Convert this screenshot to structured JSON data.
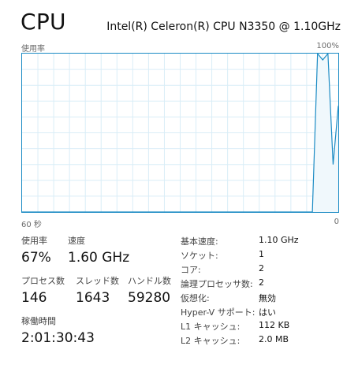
{
  "header": {
    "title": "CPU",
    "model": "Intel(R) Celeron(R) CPU N3350 @ 1.10GHz"
  },
  "graph": {
    "usage_label": "使用率",
    "max_label": "100%",
    "time_label": "60 秒",
    "min_label": "0",
    "line_color": "#1b8bc4",
    "fill_color": "#f0f8fc",
    "grid_color": "#d9edf7"
  },
  "chart_data": {
    "type": "area",
    "x": [
      60,
      59,
      58,
      57,
      56,
      55,
      54,
      53,
      52,
      51,
      50,
      49,
      48,
      47,
      46,
      45,
      44,
      43,
      42,
      41,
      40,
      39,
      38,
      37,
      36,
      35,
      34,
      33,
      32,
      31,
      30,
      29,
      28,
      27,
      26,
      25,
      24,
      23,
      22,
      21,
      20,
      19,
      18,
      17,
      16,
      15,
      14,
      13,
      12,
      11,
      10,
      9,
      8,
      7,
      6,
      5,
      4,
      3,
      2,
      1,
      0
    ],
    "values": [
      0,
      0,
      0,
      0,
      0,
      0,
      0,
      0,
      0,
      0,
      0,
      0,
      0,
      0,
      0,
      0,
      0,
      0,
      0,
      0,
      0,
      0,
      0,
      0,
      0,
      0,
      0,
      0,
      0,
      0,
      0,
      0,
      0,
      0,
      0,
      0,
      0,
      0,
      0,
      0,
      0,
      0,
      0,
      0,
      0,
      0,
      0,
      0,
      0,
      0,
      0,
      0,
      0,
      0,
      0,
      0,
      0,
      100,
      96,
      100,
      30,
      67
    ],
    "ylim": [
      0,
      100
    ]
  },
  "stats": {
    "usage": {
      "label": "使用率",
      "value": "67%"
    },
    "speed": {
      "label": "速度",
      "value": "1.60 GHz"
    },
    "processes": {
      "label": "プロセス数",
      "value": "146"
    },
    "threads": {
      "label": "スレッド数",
      "value": "1643"
    },
    "handles": {
      "label": "ハンドル数",
      "value": "59280"
    },
    "uptime": {
      "label": "稼働時間",
      "value": "2:01:30:43"
    }
  },
  "info": [
    {
      "label": "基本速度:",
      "value": "1.10 GHz"
    },
    {
      "label": "ソケット:",
      "value": "1"
    },
    {
      "label": "コア:",
      "value": "2"
    },
    {
      "label": "論理プロセッサ数:",
      "value": "2"
    },
    {
      "label": "仮想化:",
      "value": "無効"
    },
    {
      "label": "Hyper-V サポート:",
      "value": "はい"
    },
    {
      "label": "L1 キャッシュ:",
      "value": "112 KB"
    },
    {
      "label": "L2 キャッシュ:",
      "value": "2.0 MB"
    }
  ]
}
